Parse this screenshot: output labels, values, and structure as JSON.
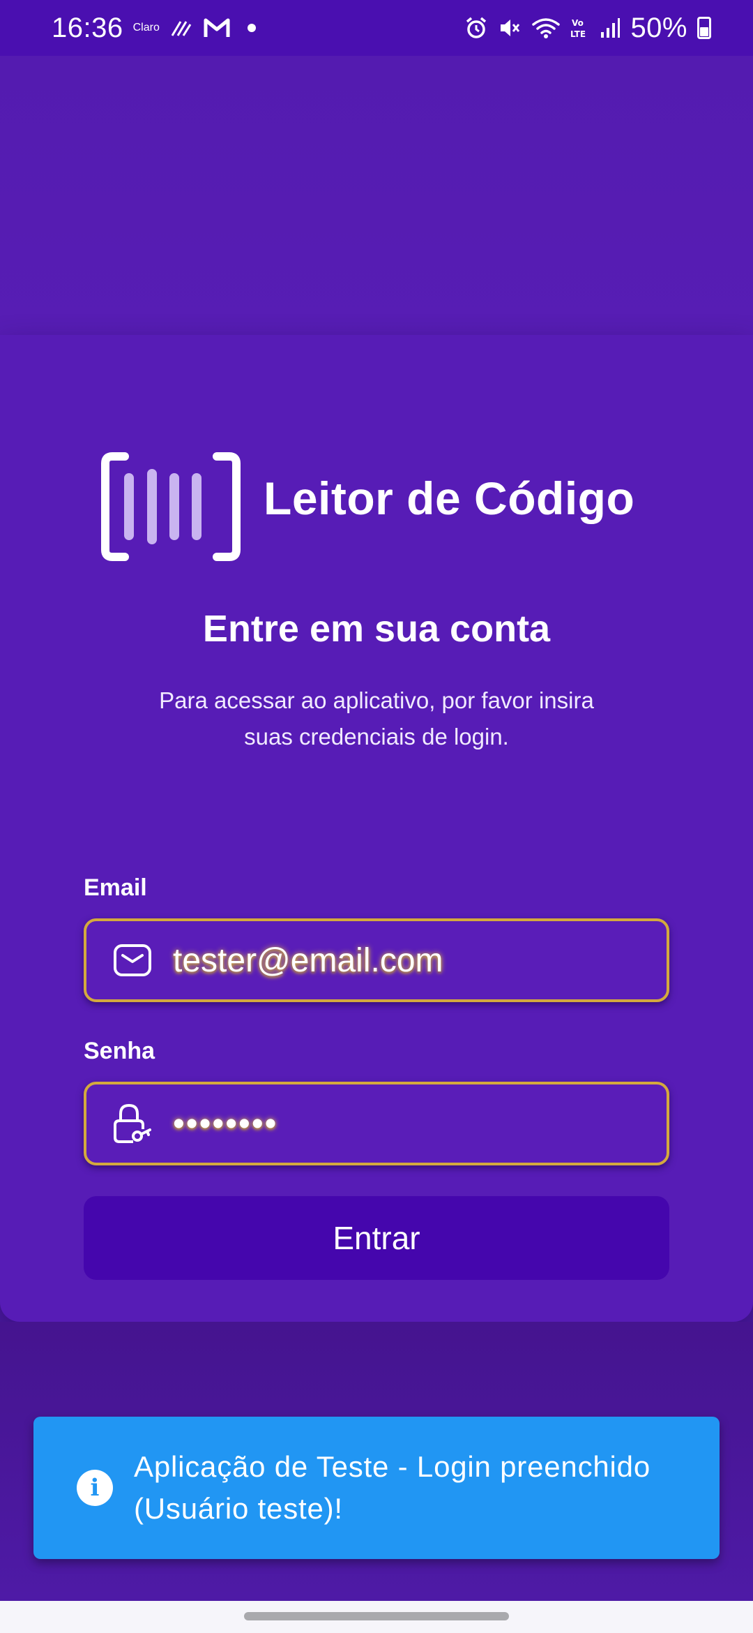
{
  "status_bar": {
    "time": "16:36",
    "carrier": "Claro",
    "battery": "50%",
    "icons": [
      "wifi-calling-icon",
      "gmail-icon",
      "notification-dot-icon",
      "alarm-icon",
      "mute-icon",
      "wifi-icon",
      "volte-icon",
      "signal-icon",
      "battery-icon"
    ]
  },
  "app": {
    "name": "Leitor de Código",
    "logo_icon": "barcode-scanner-icon"
  },
  "login": {
    "title": "Entre em sua conta",
    "subtitle": "Para acessar ao aplicativo, por favor insira suas credenciais de login.",
    "email_label": "Email",
    "email_value": "tester@email.com",
    "email_icon": "mail-icon",
    "password_label": "Senha",
    "password_value": "••••••••",
    "password_icon": "lock-key-icon",
    "submit_label": "Entrar"
  },
  "toast": {
    "icon": "info-icon",
    "message": "Aplicação de Teste - Login preenchido (Usuário teste)!",
    "color": "#2196f3"
  },
  "colors": {
    "background": "#571cb6",
    "status_bar": "#4a0fb0",
    "button": "#4506ad",
    "field_border": "#d4a93e"
  }
}
